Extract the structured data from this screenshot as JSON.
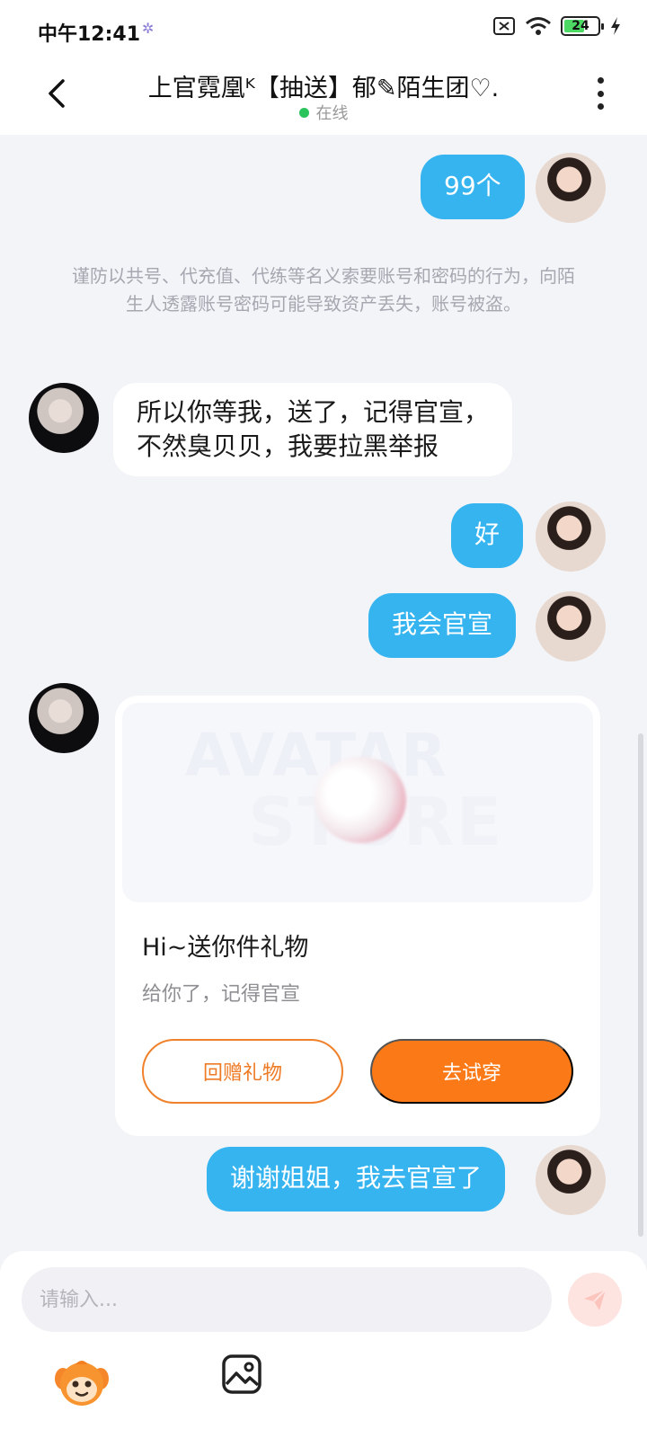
{
  "status_bar": {
    "time": "中午12:41",
    "notification_glyph": "✲",
    "battery": "24",
    "icons": [
      "sim-icon",
      "wifi-icon",
      "battery-icon",
      "charging-icon"
    ]
  },
  "header": {
    "title": "上官霓凰ᴷ【抽送】郁✎陌生团♡.",
    "status": "在线",
    "icons": [
      "back-arrow-icon",
      "more-vertical-icon"
    ]
  },
  "messages": {
    "m1": "99个",
    "notice": "谨防以共号、代充值、代练等名义索要账号和密码的行为，向陌生人透露账号密码可能导致资产丢失，账号被盗。",
    "m2_line1": "所以你等我，送了，记得官宣，",
    "m2_line2": "不然臭贝贝，我要拉黑举报",
    "m3": "好",
    "m4": "我会官宣",
    "m5": "谢谢姐姐，我去官宣了"
  },
  "gift_card": {
    "watermark_top": "AVATAR",
    "watermark_bottom": "STORE",
    "title": "Hi~送你件礼物",
    "subtitle": "给你了，记得官宣",
    "return_label": "回赠礼物",
    "try_label": "去试穿"
  },
  "composer": {
    "placeholder": "请输入...",
    "icons": [
      "send-icon",
      "emoji-icon",
      "image-icon"
    ]
  },
  "colors": {
    "sent_bubble": "#35b4f0",
    "accent_orange": "#fb7a17",
    "online_green": "#2bc35c"
  }
}
